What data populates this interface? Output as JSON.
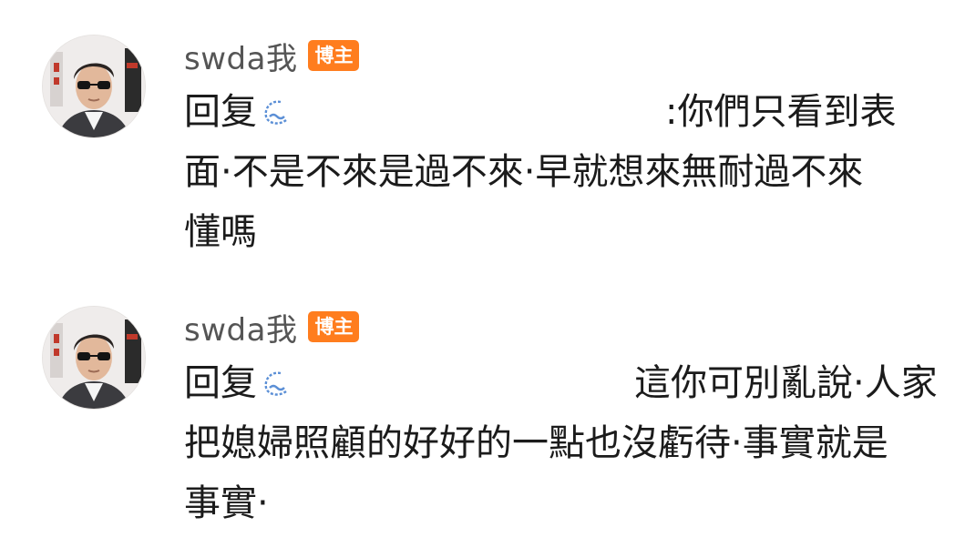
{
  "comments": [
    {
      "username": "swda我",
      "badge": "博主",
      "reply_prefix": "回复",
      "text_after_name": ":你們只看到表",
      "lines": [
        "面·不是不來是過不來·早就想來無耐過不來",
        "懂嗎"
      ],
      "avatar_icon": "avatar-man-sunglasses-icon",
      "reply_mention_icon": "emoji-wave-icon"
    },
    {
      "username": "swda我",
      "badge": "博主",
      "reply_prefix": "回复",
      "text_after_name": "這你可別亂說·人家",
      "lines": [
        "把媳婦照顧的好好的一點也沒虧待·事實就是",
        "事實·"
      ],
      "avatar_icon": "avatar-man-sunglasses-icon",
      "reply_mention_icon": "emoji-wave-icon"
    }
  ],
  "colors": {
    "badge_bg": "#ff7d1e",
    "username": "#555555",
    "text": "#1b1b1b",
    "icon_blue": "#5b8fd6"
  }
}
